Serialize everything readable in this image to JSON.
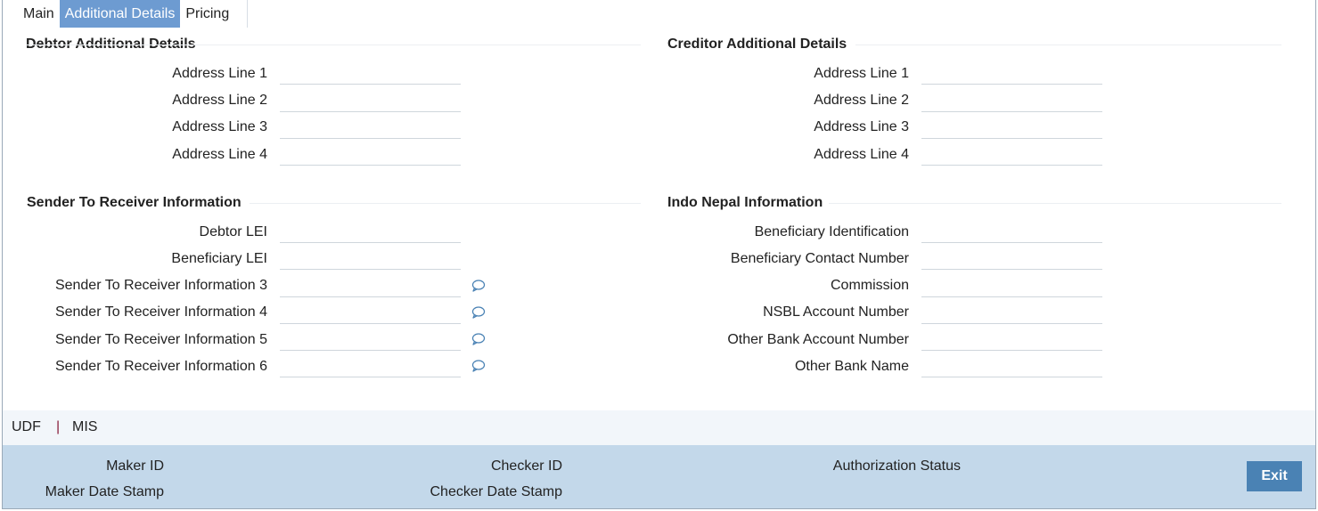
{
  "tabs": [
    {
      "label": "Main",
      "active": false
    },
    {
      "label": "Additional Details",
      "active": true
    },
    {
      "label": "Pricing",
      "active": false
    }
  ],
  "debtor": {
    "title": "Debtor Additional Details",
    "fields": [
      {
        "label": "Address Line 1",
        "value": ""
      },
      {
        "label": "Address Line 2",
        "value": ""
      },
      {
        "label": "Address Line 3",
        "value": ""
      },
      {
        "label": "Address Line 4",
        "value": ""
      }
    ]
  },
  "creditor": {
    "title": "Creditor Additional Details",
    "fields": [
      {
        "label": "Address Line 1",
        "value": ""
      },
      {
        "label": "Address Line 2",
        "value": ""
      },
      {
        "label": "Address Line 3",
        "value": ""
      },
      {
        "label": "Address Line 4",
        "value": ""
      }
    ]
  },
  "sender_receiver": {
    "title": "Sender To Receiver Information",
    "fields": [
      {
        "label": "Debtor LEI",
        "value": ""
      },
      {
        "label": "Beneficiary LEI",
        "value": ""
      },
      {
        "label": "Sender To Receiver Information 3",
        "value": ""
      },
      {
        "label": "Sender To Receiver Information 4",
        "value": ""
      },
      {
        "label": "Sender To Receiver Information 5",
        "value": ""
      },
      {
        "label": "Sender To Receiver Information 6",
        "value": ""
      }
    ]
  },
  "indo_nepal": {
    "title": "Indo Nepal Information",
    "fields": [
      {
        "label": "Beneficiary Identification",
        "value": ""
      },
      {
        "label": "Beneficiary Contact Number",
        "value": ""
      },
      {
        "label": "Commission",
        "value": ""
      },
      {
        "label": "NSBL Account Number",
        "value": ""
      },
      {
        "label": "Other Bank Account Number",
        "value": ""
      },
      {
        "label": "Other Bank Name",
        "value": ""
      }
    ]
  },
  "footer_links": {
    "udf": "UDF",
    "separator": "|",
    "mis": "MIS"
  },
  "audit": {
    "maker_id": "Maker ID",
    "maker_date_stamp": "Maker Date Stamp",
    "checker_id": "Checker ID",
    "checker_date_stamp": "Checker Date Stamp",
    "authorization_status": "Authorization Status"
  },
  "exit_label": "Exit",
  "colors": {
    "active_tab": "#6d9bd1",
    "audit_bar": "#c3d8ea",
    "exit_button": "#4a82b4",
    "icon": "#4a82b4"
  }
}
